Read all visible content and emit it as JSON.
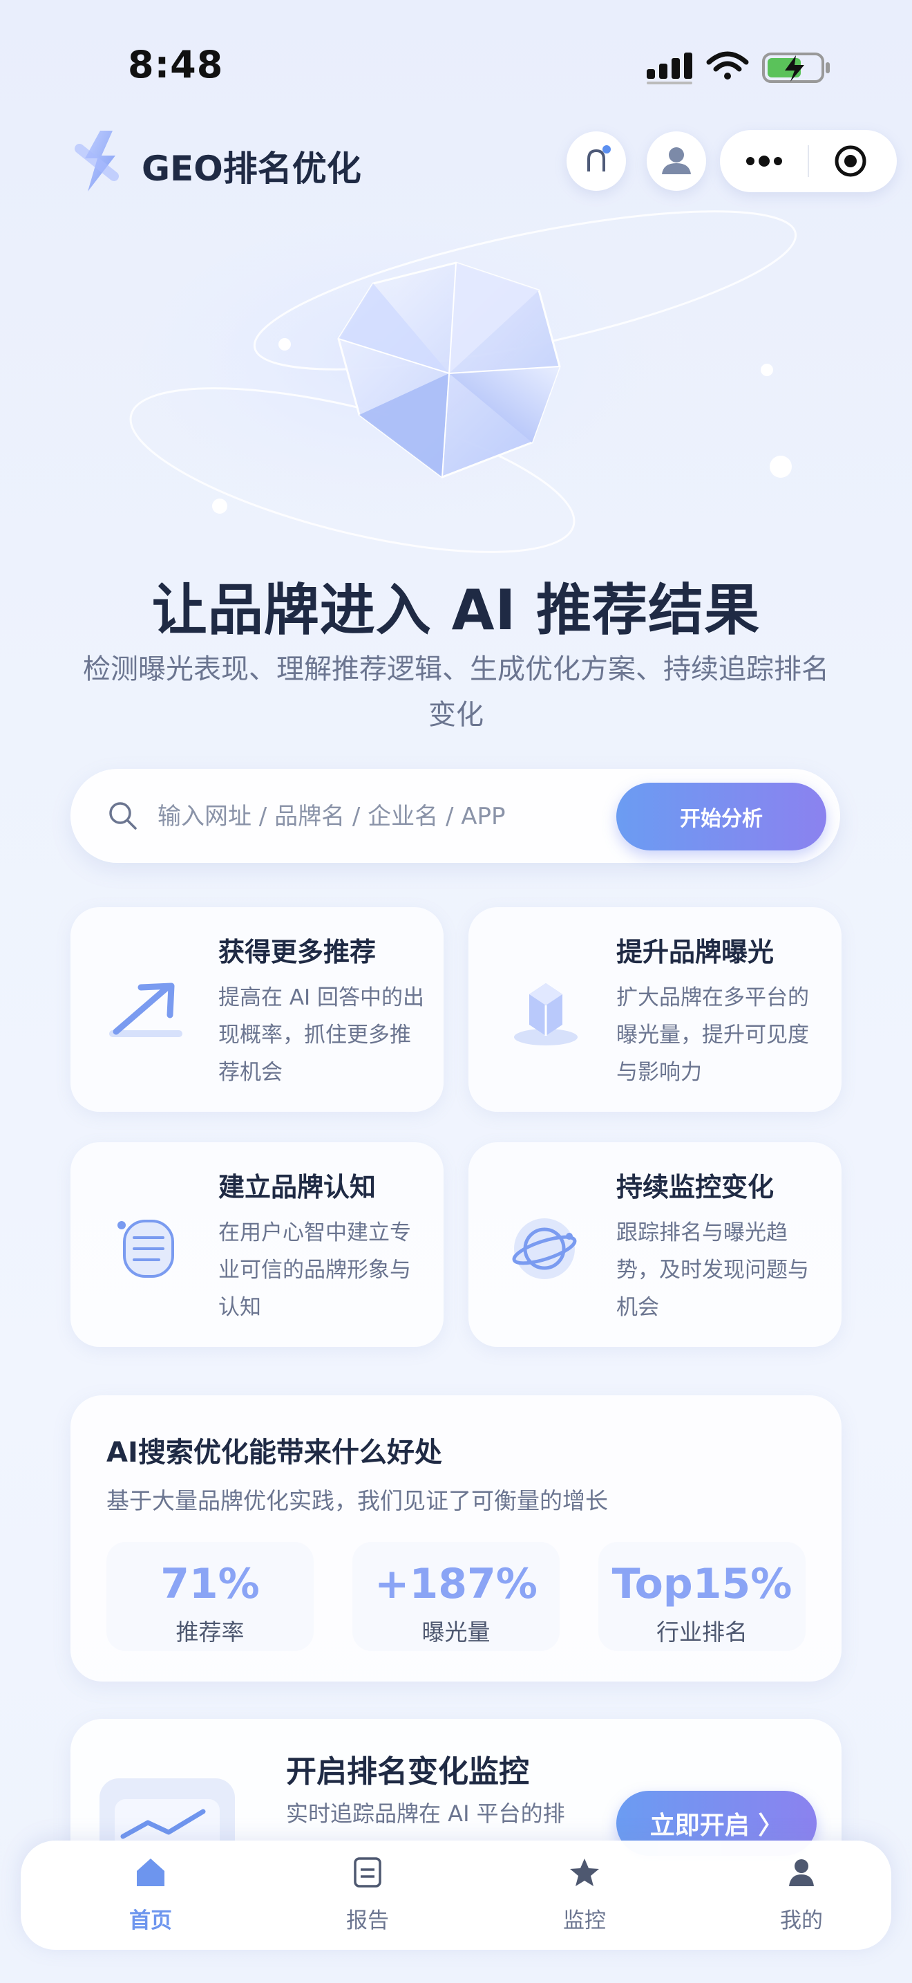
{
  "status_bar": {
    "time": "8:48"
  },
  "header": {
    "title": "GEO排名优化"
  },
  "hero": {
    "title": "让品牌进入 AI 推荐结果",
    "subtitle": "检测曝光表现、理解推荐逻辑、生成优化方案、持续追踪排名变化"
  },
  "search": {
    "placeholder": "输入网址 / 品牌名 / 企业名 / APP",
    "button_label": "开始分析"
  },
  "features": [
    {
      "title": "获得更多推荐",
      "desc": "提高在 AI 回答中的出现概率，抓住更多推荐机会",
      "icon": "arrow-up-right-icon"
    },
    {
      "title": "提升品牌曝光",
      "desc": "扩大品牌在多平台的曝光量，提升可见度与影响力",
      "icon": "crystal-icon"
    },
    {
      "title": "建立品牌认知",
      "desc": "在用户心智中建立专业可信的品牌形象与认知",
      "icon": "document-icon"
    },
    {
      "title": "持续监控变化",
      "desc": "跟踪排名与曝光趋势，及时发现问题与机会",
      "icon": "planet-icon"
    }
  ],
  "benefits": {
    "title": "AI搜索优化能带来什么好处",
    "subtitle": "基于大量品牌优化实践，我们见证了可衡量的增长",
    "stats": [
      {
        "value": "71%",
        "label": "推荐率"
      },
      {
        "value": "+187%",
        "label": "曝光量"
      },
      {
        "value": "Top15%",
        "label": "行业排名"
      }
    ]
  },
  "monitor": {
    "title": "开启排名变化监控",
    "desc": "实时追踪品牌在 AI 平台的排",
    "button_label": "立即开启 〉"
  },
  "tabbar": {
    "items": [
      {
        "label": "首页",
        "icon": "home-icon",
        "active": true
      },
      {
        "label": "报告",
        "icon": "report-icon",
        "active": false
      },
      {
        "label": "监控",
        "icon": "star-icon",
        "active": false
      },
      {
        "label": "我的",
        "icon": "user-icon",
        "active": false
      }
    ]
  },
  "colors": {
    "accent": "#6d95ee",
    "stat": "#8aa4f5",
    "title": "#1f2a44",
    "muted": "#6b7590"
  }
}
